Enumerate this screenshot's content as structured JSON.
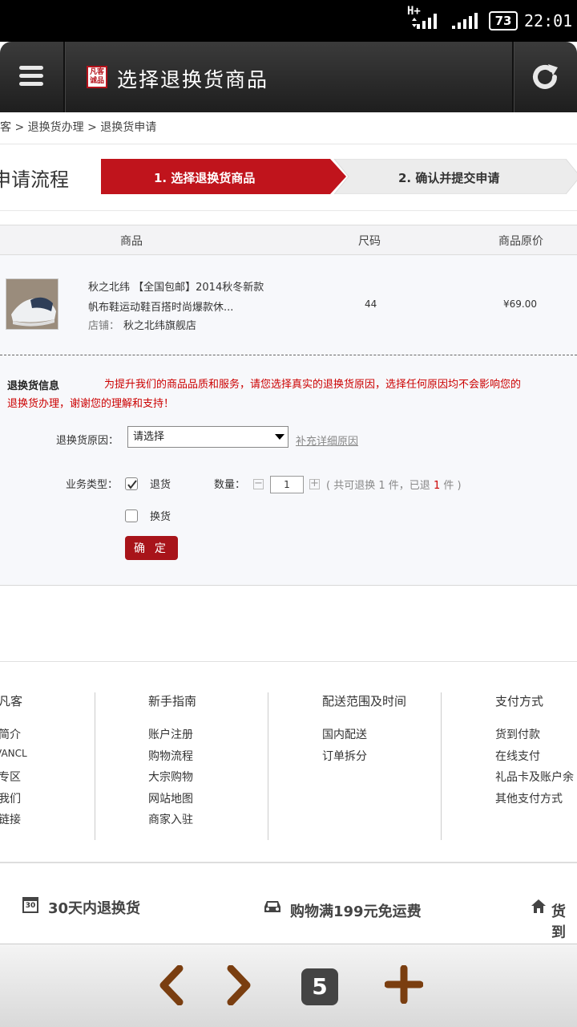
{
  "status_bar": {
    "network": "H+",
    "battery": "73",
    "time": "22:01"
  },
  "header": {
    "logo_text": "凡客诚品",
    "title": "选择退换货商品"
  },
  "breadcrumb": "客 > 退换货办理 > 退换货申请",
  "process": {
    "label": "申请流程",
    "steps": [
      {
        "label": "1. 选择退换货商品",
        "active": true
      },
      {
        "label": "2. 确认并提交申请",
        "active": false
      }
    ]
  },
  "table": {
    "headers": {
      "product": "商品",
      "size": "尺码",
      "price": "商品原价"
    },
    "rows": [
      {
        "title_line1": "秋之北纬 【全国包邮】2014秋冬新款",
        "title_line2": "帆布鞋运动鞋百搭时尚爆款休...",
        "shop_label": "店铺：",
        "shop_name": "秋之北纬旗舰店",
        "size": "44",
        "price": "¥69.00"
      }
    ]
  },
  "return_info": {
    "heading": "退换货信息",
    "notice_line1": "为提升我们的商品品质和服务，请您选择真实的退换货原因，选择任何原因均不会影响您的",
    "notice_line2": "退换货办理，谢谢您的理解和支持！",
    "reason_label": "退换货原因：",
    "reason_value": "请选择",
    "reason_link": "补充详细原因",
    "type_label": "业务类型：",
    "option_return": "退货",
    "option_exchange": "换货",
    "qty_label": "数量：",
    "qty_value": "1",
    "qty_note_prefix": "( 共可退换",
    "qty_total": "1",
    "qty_note_mid": "件，已退",
    "qty_returned": "1",
    "qty_note_suffix": "件 )",
    "confirm_label": "确 定"
  },
  "footer": {
    "columns": [
      {
        "heading": "凡客",
        "links": [
          "简介",
          "VANCL",
          "专区",
          "我们",
          "链接"
        ]
      },
      {
        "heading": "新手指南",
        "links": [
          "账户注册",
          "购物流程",
          "大宗购物",
          "网站地图",
          "商家入驻"
        ]
      },
      {
        "heading": "配送范围及时间",
        "links": [
          "国内配送",
          "订单拆分"
        ]
      },
      {
        "heading": "支付方式",
        "links": [
          "货到付款",
          "在线支付",
          "礼品卡及账户余",
          "其他支付方式"
        ]
      }
    ]
  },
  "promo": {
    "calendar_num": "30",
    "item1": "30天内退换货",
    "item2": "购物满199元免运费",
    "item3": "货到"
  },
  "bottom_nav": {
    "tab_count": "5"
  },
  "colors": {
    "brand_red": "#b5121b",
    "notice_red": "#c00000",
    "step_active": "#c0141c"
  }
}
